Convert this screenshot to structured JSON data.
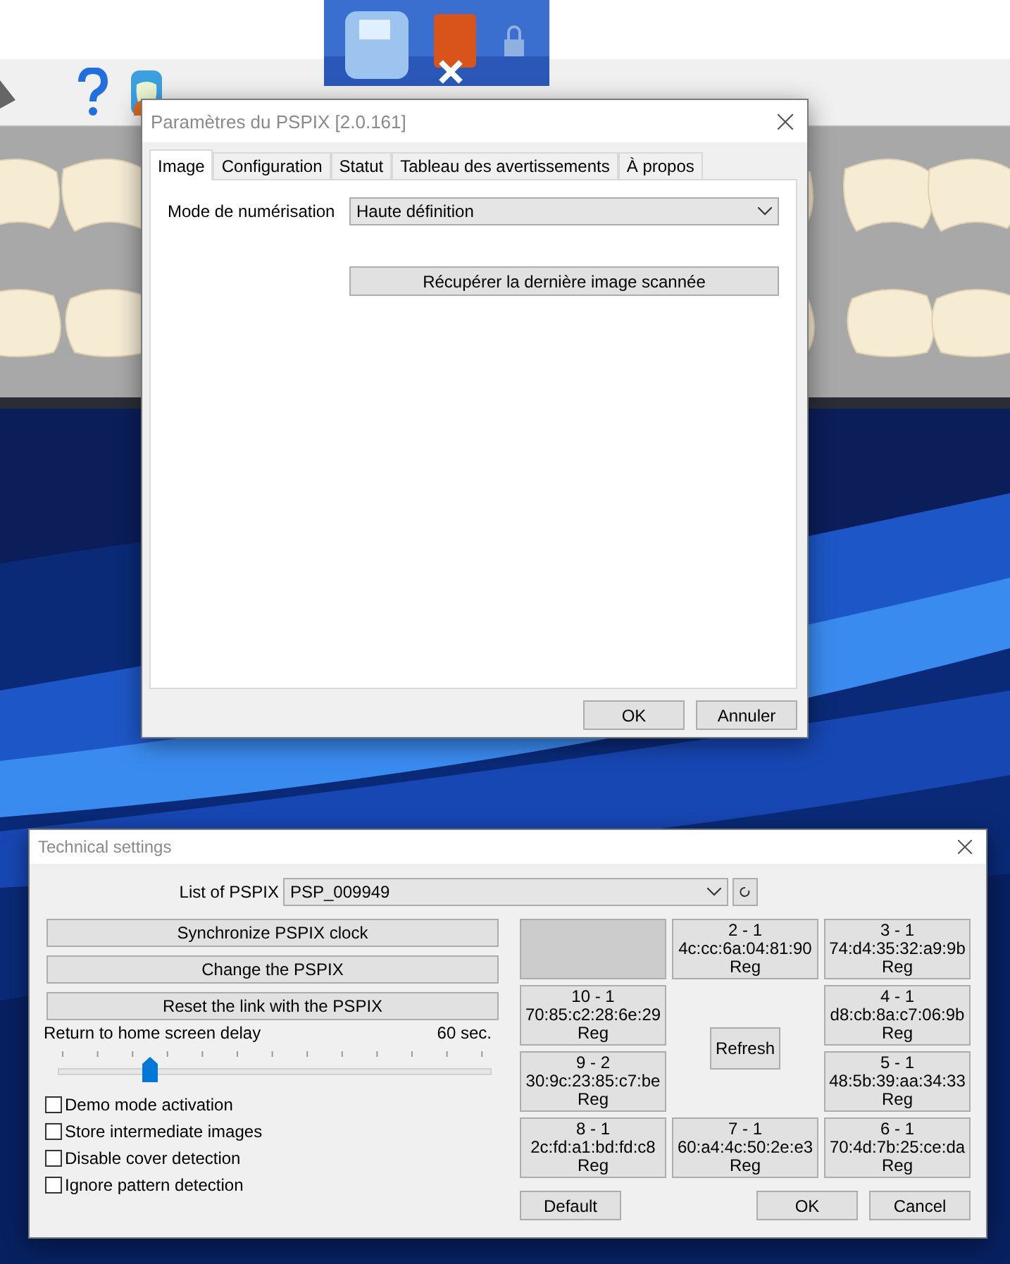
{
  "image_dialog": {
    "title": "Paramètres du PSPIX [2.0.161]",
    "tabs": [
      {
        "label": "Image",
        "selected": true
      },
      {
        "label": "Configuration",
        "selected": false
      },
      {
        "label": "Statut",
        "selected": false
      },
      {
        "label": "Tableau des avertissements",
        "selected": false
      },
      {
        "label": "À propos",
        "selected": false
      }
    ],
    "scan_mode": {
      "label": "Mode de numérisation",
      "value": "Haute définition"
    },
    "retrieve_button": "Récupérer la dernière image scannée",
    "buttons": [
      "OK",
      "Annuler"
    ]
  },
  "technical_dialog": {
    "title": "Technical settings",
    "pspix_list": {
      "label": "List of PSPIX",
      "value": "PSP_009949"
    },
    "actions": [
      "Synchronize PSPIX clock",
      "Change the PSPIX",
      "Reset the link with the PSPIX"
    ],
    "delay": {
      "label": "Return to home screen delay",
      "reading": "60 sec.",
      "level": 0.2
    },
    "options": [
      {
        "label": "Demo mode activation",
        "checked": false
      },
      {
        "label": "Store intermediate images",
        "checked": false
      },
      {
        "label": "Disable cover detection",
        "checked": false
      },
      {
        "label": "Ignore pattern detection",
        "checked": false
      }
    ],
    "devices": [
      {
        "kind": "blank"
      },
      {
        "kind": "device",
        "slot": "2 - 1",
        "mac": "4c:cc:6a:04:81:90",
        "status": "Reg"
      },
      {
        "kind": "device",
        "slot": "3 - 1",
        "mac": "74:d4:35:32:a9:9b",
        "status": "Reg"
      },
      {
        "kind": "device",
        "slot": "10 - 1",
        "mac": "70:85:c2:28:6e:29",
        "status": "Reg"
      },
      {
        "kind": "device",
        "slot": "4 - 1",
        "mac": "d8:cb:8a:c7:06:9b",
        "status": "Reg"
      },
      {
        "kind": "device",
        "slot": "9 - 2",
        "mac": "30:9c:23:85:c7:be",
        "status": "Reg"
      },
      {
        "kind": "device",
        "slot": "5 - 1",
        "mac": "48:5b:39:aa:34:33",
        "status": "Reg"
      },
      {
        "kind": "device",
        "slot": "8 - 1",
        "mac": "2c:fd:a1:bd:fd:c8",
        "status": "Reg"
      },
      {
        "kind": "device",
        "slot": "7 - 1",
        "mac": "60:a4:4c:50:2e:e3",
        "status": "Reg"
      },
      {
        "kind": "device",
        "slot": "6 - 1",
        "mac": "70:4d:7b:25:ce:da",
        "status": "Reg"
      }
    ],
    "refresh_button": "Refresh",
    "footer": {
      "left": [
        "Default"
      ],
      "right": [
        "OK",
        "Cancel"
      ]
    }
  }
}
